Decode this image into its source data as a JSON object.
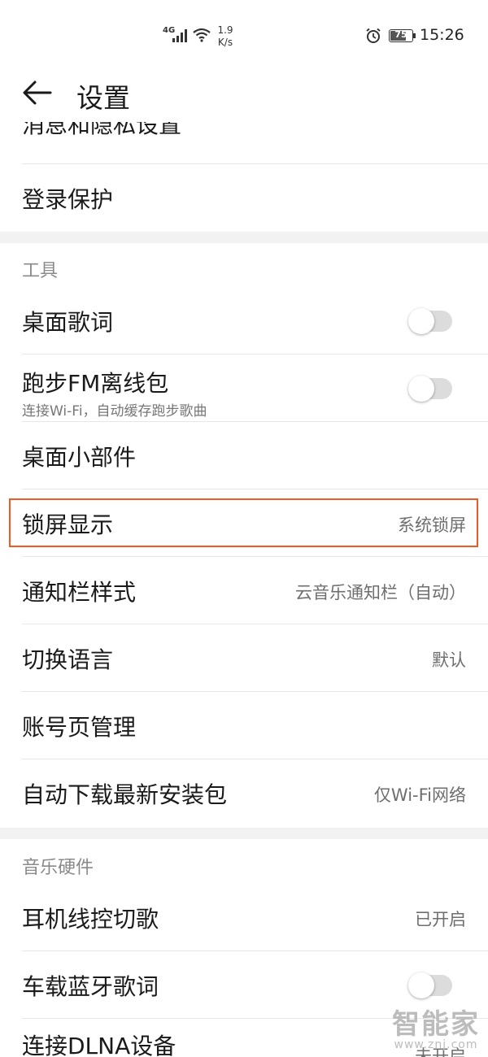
{
  "status_bar": {
    "network_type": "4G",
    "speed_value": "1.9",
    "speed_unit": "K/s",
    "battery": "75",
    "battery_level_percent": 75,
    "time": "15:26"
  },
  "header": {
    "title": "设置"
  },
  "top_partial": {
    "label": "消息和隐私设置"
  },
  "rows_top": [
    {
      "label": "登录保护"
    }
  ],
  "sections": [
    {
      "title": "工具",
      "items": [
        {
          "label": "桌面歌词",
          "toggle": false
        },
        {
          "label": "跑步FM离线包",
          "sub": "连接Wi-Fi，自动缓存跑步歌曲",
          "toggle": false
        },
        {
          "label": "桌面小部件"
        },
        {
          "label": "锁屏显示",
          "value": "系统锁屏"
        },
        {
          "label": "通知栏样式",
          "value": "云音乐通知栏（自动）"
        },
        {
          "label": "切换语言",
          "value": "默认"
        },
        {
          "label": "账号页管理"
        },
        {
          "label": "自动下载最新安装包",
          "value": "仅Wi-Fi网络"
        }
      ]
    },
    {
      "title": "音乐硬件",
      "items": [
        {
          "label": "耳机线控切歌",
          "value": "已开启"
        },
        {
          "label": "车载蓝牙歌词",
          "toggle": false
        },
        {
          "label": "连接DLNA设备",
          "value": "未开启"
        }
      ]
    }
  ],
  "watermark": {
    "main": "智能家",
    "sub": "www.znj.com"
  },
  "colors": {
    "highlight": "#f05a28",
    "divider": "#e8e8e8",
    "section_bg": "#f2f2f2"
  }
}
